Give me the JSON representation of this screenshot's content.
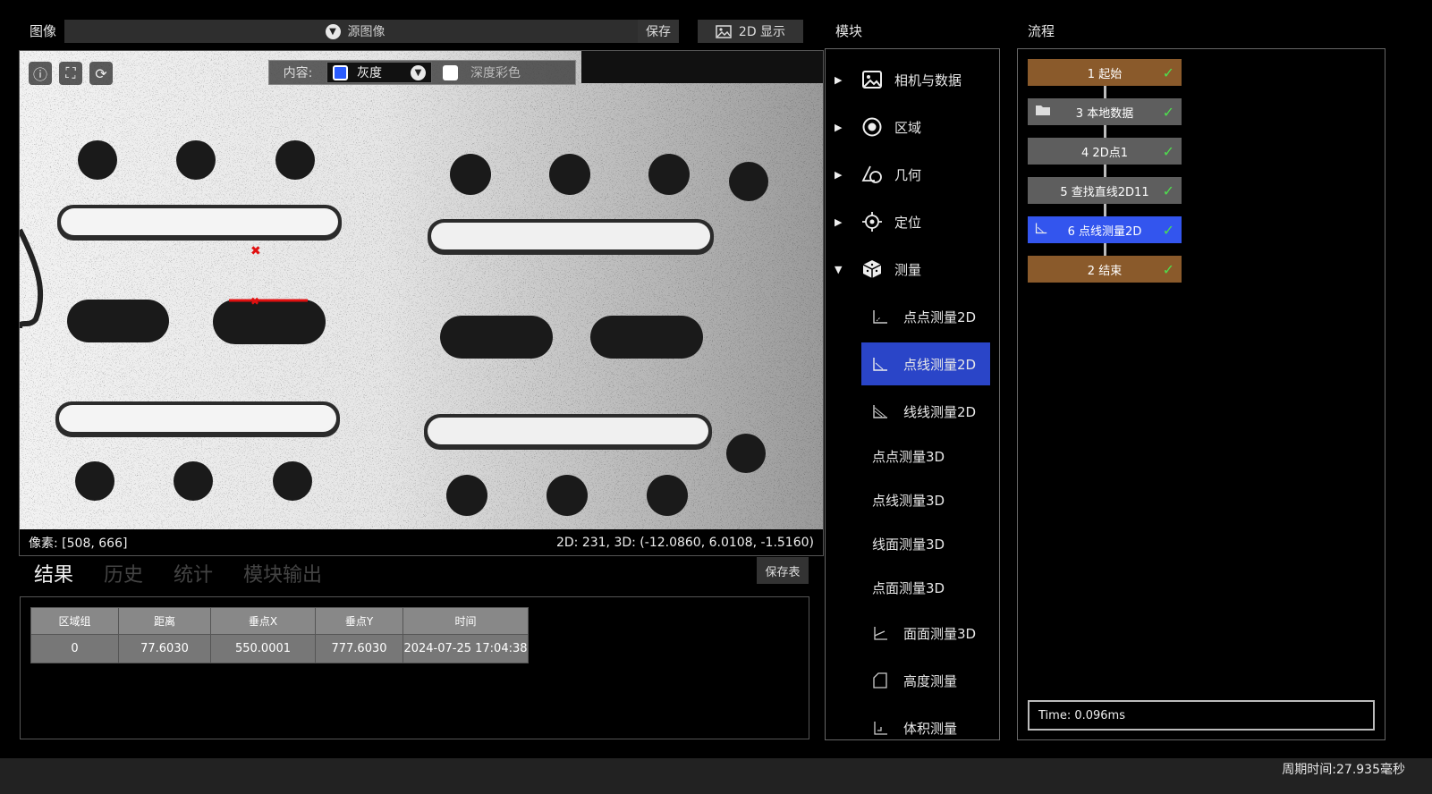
{
  "image_section": {
    "title": "图像",
    "source_select": "源图像",
    "save_button": "保存",
    "separator": "|",
    "display_button": "2D 显示",
    "content_label": "内容:",
    "content_value": "灰度",
    "depth_label": "深度彩色",
    "pixel_readout": "像素: [508, 666]",
    "coord_readout": "2D: 231, 3D: (-12.0860, 6.0108, -1.5160)"
  },
  "results": {
    "tabs": [
      "结果",
      "历史",
      "统计",
      "模块输出"
    ],
    "save_table_button": "保存表",
    "columns": [
      "区域组",
      "距离",
      "垂点X",
      "垂点Y",
      "时间"
    ],
    "rows": [
      [
        "0",
        "77.6030",
        "550.0001",
        "777.6030",
        "2024-07-25 17:04:38"
      ]
    ]
  },
  "modules": {
    "title": "模块",
    "categories": [
      {
        "label": "相机与数据",
        "icon": "image-icon",
        "arrow": "▶"
      },
      {
        "label": "区域",
        "icon": "region-icon",
        "arrow": "▶"
      },
      {
        "label": "几何",
        "icon": "geometry-icon",
        "arrow": "▶"
      },
      {
        "label": "定位",
        "icon": "locate-icon",
        "arrow": "▶"
      },
      {
        "label": "测量",
        "icon": "cube-icon",
        "arrow": "▼"
      }
    ],
    "sub_items": [
      "点点测量2D",
      "点线测量2D",
      "线线测量2D",
      "点点测量3D",
      "点线测量3D",
      "线面测量3D",
      "点面测量3D",
      "面面测量3D",
      "高度测量",
      "体积测量"
    ],
    "selected": "点线测量2D"
  },
  "flow": {
    "title": "流程",
    "nodes": [
      {
        "label": "1 起始",
        "color": "#8a5a2b"
      },
      {
        "label": "3 本地数据",
        "color": "#5e5e5e"
      },
      {
        "label": "4 2D点1",
        "color": "#5e5e5e"
      },
      {
        "label": "5 查找直线2D11",
        "color": "#5e5e5e"
      },
      {
        "label": "6 点线测量2D",
        "color": "#3355ee"
      },
      {
        "label": "2 结束",
        "color": "#8a5a2b"
      }
    ],
    "time": "Time: 0.096ms"
  },
  "status": {
    "cycle_time": "周期时间:27.935毫秒"
  }
}
